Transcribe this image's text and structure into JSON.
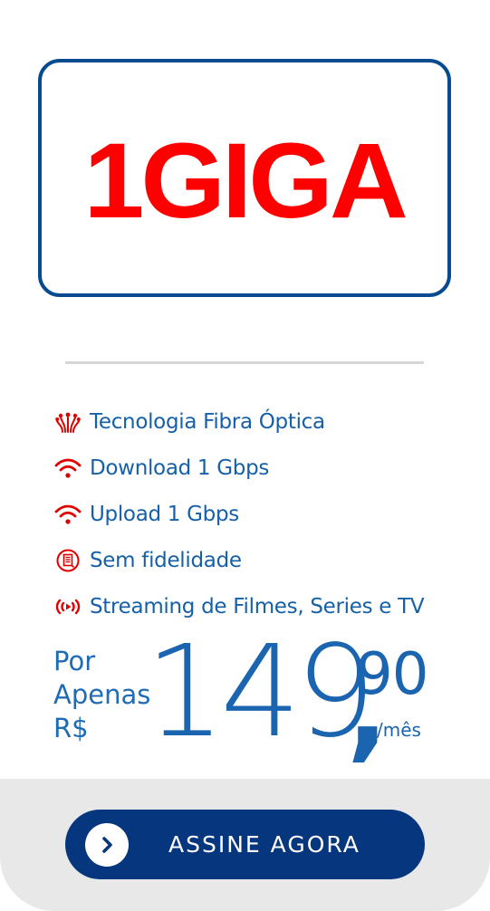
{
  "plan": {
    "name": "1GIGA"
  },
  "colors": {
    "brand_blue": "#064a8f",
    "accent_red": "#ff0000",
    "text_blue": "#1560a8",
    "button_blue": "#06367d",
    "footer_gray": "#e8e8e8"
  },
  "features": [
    {
      "icon": "fiber-optic-icon",
      "label": "Tecnologia Fibra Óptica"
    },
    {
      "icon": "wifi-icon",
      "label": "Download 1 Gbps"
    },
    {
      "icon": "wifi-icon",
      "label": "Upload 1 Gbps"
    },
    {
      "icon": "contract-icon",
      "label": "Sem fidelidade"
    },
    {
      "icon": "streaming-icon",
      "label": "Streaming de Filmes, Series e TV"
    }
  ],
  "price": {
    "line1": "Por",
    "line2": "Apenas",
    "line3": "R$",
    "integer": "149",
    "comma": ",",
    "cents": "90",
    "period": "/mês"
  },
  "cta": {
    "icon": "chevron-right-icon",
    "label": "ASSINE AGORA"
  }
}
